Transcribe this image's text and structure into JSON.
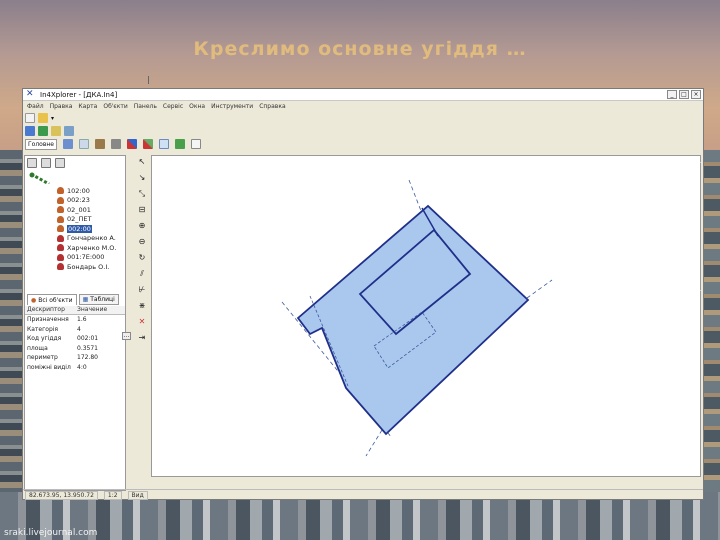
{
  "slide": {
    "title": "Креслимо основне угіддя …",
    "credit": "sraki.livejournal.com"
  },
  "window": {
    "title": "In4Xplorer - [ДКА.In4]",
    "buttons": {
      "minimize": "_",
      "restore": "□",
      "close": "×"
    }
  },
  "menu": [
    "Файл",
    "Правка",
    "Карта",
    "Об'єкти",
    "Панель",
    "Сервіс",
    "Окна",
    "Инструменти",
    "Справка"
  ],
  "toolbar": {
    "tab_label": "Головне"
  },
  "tree": {
    "items": [
      {
        "label": "102:00",
        "selected": false,
        "color": "#c0622a"
      },
      {
        "label": "002:23",
        "selected": false,
        "color": "#c0622a"
      },
      {
        "label": "02_001",
        "selected": false,
        "color": "#c0622a"
      },
      {
        "label": "02_ПЕТ",
        "selected": false,
        "color": "#c0622a"
      },
      {
        "label": "002:00",
        "selected": true,
        "color": "#c0622a"
      },
      {
        "label": "Гончаренко А.",
        "selected": false,
        "color": "#b53030"
      },
      {
        "label": "Харченко М.О.",
        "selected": false,
        "color": "#b53030"
      },
      {
        "label": "001:7Е:000",
        "selected": false,
        "color": "#b53030"
      },
      {
        "label": "Бондарь О.І.",
        "selected": false,
        "color": "#b53030"
      }
    ]
  },
  "panel_tabs": {
    "objects": "Всі об'єкти",
    "templates": "Таблиці"
  },
  "properties": {
    "headers": [
      "Дескриптор",
      "Значение"
    ],
    "rows": [
      {
        "key": "Призначення",
        "value": "1.6"
      },
      {
        "key": "Категорія",
        "value": "4"
      },
      {
        "key": "Код угіддя",
        "value": "002:01"
      },
      {
        "key": "площа",
        "value": "0.3571"
      },
      {
        "key": "периметр",
        "value": "172.80"
      },
      {
        "key": "поміжні виділ",
        "value": "4:0"
      }
    ]
  },
  "status": {
    "coords": "82.673.95, 13.950.72",
    "scale": "1:2",
    "mode": "Вид"
  }
}
